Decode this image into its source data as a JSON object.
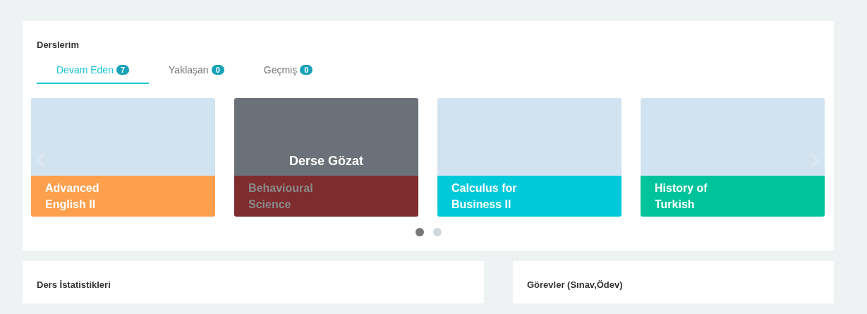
{
  "courses_panel": {
    "title": "Derslerim",
    "tabs": [
      {
        "label": "Devam Eden",
        "count": "7",
        "selected": true
      },
      {
        "label": "Yaklaşan",
        "count": "0",
        "selected": false
      },
      {
        "label": "Geçmiş",
        "count": "0",
        "selected": false
      }
    ],
    "cards": [
      {
        "name": "Advanced English II",
        "color": "#fda04e",
        "hovered": false
      },
      {
        "name": "Behavioural Science",
        "color": "#7f2c2f",
        "hovered": true,
        "overlay_label": "Derse Gözat"
      },
      {
        "name": "Calculus for Business II",
        "color": "#00c9d9",
        "hovered": false
      },
      {
        "name": "History of Turkish",
        "color": "#00c39b",
        "hovered": false
      }
    ],
    "dots": [
      {
        "selected": true
      },
      {
        "selected": false
      }
    ]
  },
  "stats_panel": {
    "title": "Ders İstatistikleri"
  },
  "tasks_panel": {
    "title": "Görevler (Sınav,Ödev)"
  }
}
